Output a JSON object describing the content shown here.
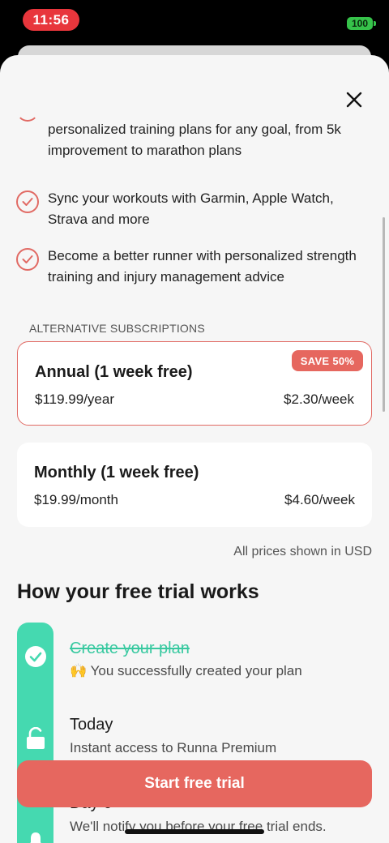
{
  "status": {
    "time": "11:56",
    "battery": "100"
  },
  "features": [
    {
      "text": "personalized training plans for any goal, from 5k improvement to marathon plans"
    },
    {
      "text": "Sync your workouts with Garmin, Apple Watch, Strava and more"
    },
    {
      "text": "Become a better runner with personalized strength training and injury management advice"
    }
  ],
  "subscriptions": {
    "label": "ALTERNATIVE SUBSCRIPTIONS",
    "plans": [
      {
        "title": "Annual  (1 week free)",
        "price": "$119.99/year",
        "per_week": "$2.30/week",
        "badge": "SAVE 50%",
        "selected": true
      },
      {
        "title": "Monthly  (1 week free)",
        "price": "$19.99/month",
        "per_week": "$4.60/week",
        "selected": false
      }
    ],
    "note": "All prices shown in USD"
  },
  "trial": {
    "heading": "How your free trial works",
    "steps": [
      {
        "title": "Create your plan",
        "desc": "🙌 You successfully created your plan",
        "icon": "check-icon",
        "done": true
      },
      {
        "title": "Today",
        "desc": "Instant access to Runna Premium",
        "icon": "unlock-icon",
        "done": false
      },
      {
        "title": "Day 6",
        "desc": "We'll notify you before your free trial ends.",
        "icon": "bell-icon",
        "done": false
      }
    ]
  },
  "cta": {
    "label": "Start free trial"
  },
  "colors": {
    "accent": "#e6675f",
    "teal": "#45d9b0",
    "status_red": "#e8363c",
    "battery_green": "#36c24a"
  }
}
